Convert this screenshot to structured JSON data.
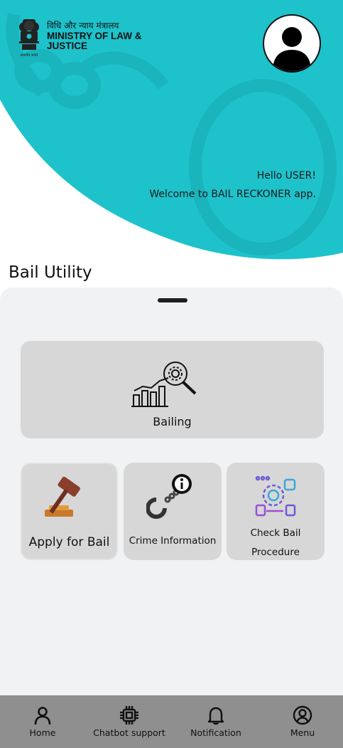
{
  "header": {
    "ministry_hindi": "विधि और न्याय मंत्रालय",
    "ministry_english": "MINISTRY OF LAW & JUSTICE",
    "greeting_line1": "Hello USER!",
    "greeting_line2": "Welcome to BAIL RECKONER app."
  },
  "section_title": "Bail Utility",
  "cards": {
    "bailing": "Bailing",
    "apply": "Apply for Bail",
    "crime": "Crime Information",
    "check_line1": "Check Bail",
    "check_line2": "Procedure"
  },
  "nav": [
    {
      "label": "Home",
      "icon": "person-icon"
    },
    {
      "label": "Chatbot support",
      "icon": "chip-icon"
    },
    {
      "label": "Notification",
      "icon": "bell-icon"
    },
    {
      "label": "Menu",
      "icon": "account-circle-icon"
    }
  ],
  "colors": {
    "header_teal": "#1ec2cb",
    "sheet_bg": "#f1f2f4",
    "card_bg": "#d7d7d7",
    "nav_bg": "#8f8f8f"
  }
}
